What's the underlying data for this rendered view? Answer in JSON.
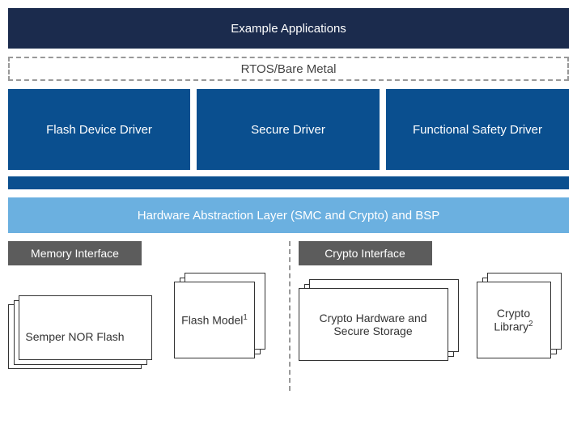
{
  "layers": {
    "applications": "Example Applications",
    "rtos": "RTOS/Bare Metal",
    "hal": "Hardware Abstraction Layer (SMC and Crypto) and BSP"
  },
  "drivers": {
    "flash": "Flash Device Driver",
    "secure": "Secure Driver",
    "safety": "Functional Safety Driver"
  },
  "interfaces": {
    "memory": {
      "label": "Memory Interface",
      "doc1": "Semper NOR Flash",
      "doc2": "Flash Model",
      "doc2_sup": "1"
    },
    "crypto": {
      "label": "Crypto Interface",
      "doc1": "Crypto Hardware and Secure Storage",
      "doc2": "Crypto Library",
      "doc2_sup": "2"
    }
  },
  "colors": {
    "dark_navy": "#1b2b4d",
    "navy": "#0a4f8f",
    "light_blue": "#6bb0e0",
    "gray": "#5c5c5c"
  }
}
